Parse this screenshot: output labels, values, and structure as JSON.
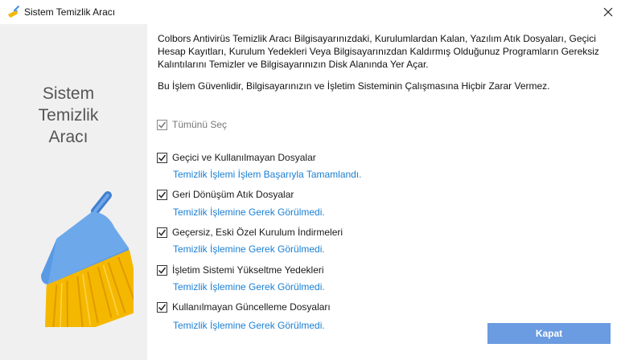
{
  "window": {
    "title": "Sistem Temizlik Aracı",
    "icon": "broom-icon"
  },
  "sidebar": {
    "heading": "Sistem\nTemizlik\nAracı",
    "illustration": "broom-icon"
  },
  "main": {
    "description": "Colbors Antivirüs Temizlik Aracı Bilgisayarınızdaki, Kurulumlardan Kalan, Yazılım Atık Dosyaları, Geçici Hesap Kayıtları, Kurulum Yedekleri Veya Bilgisayarınızdan Kaldırmış Olduğunuz Programların Gereksiz Kalıntılarını Temizler ve Bilgisayarınızın Disk Alanında Yer Açar.",
    "safety_note": "Bu İşlem Güvenlidir, Bilgisayarınızın ve İşletim Sisteminin Çalışmasına Hiçbir Zarar Vermez.",
    "select_all": {
      "label": "Tümünü Seç",
      "checked": true,
      "disabled": true
    },
    "items": [
      {
        "label": "Geçici ve Kullanılmayan Dosyalar",
        "checked": true,
        "status": "Temizlik İşlemi İşlem Başarıyla Tamamlandı."
      },
      {
        "label": "Geri Dönüşüm Atık Dosyalar",
        "checked": true,
        "status": "Temizlik İşlemine Gerek Görülmedi."
      },
      {
        "label": "Geçersiz, Eski Özel Kurulum İndirmeleri",
        "checked": true,
        "status": "Temizlik İşlemine Gerek Görülmedi."
      },
      {
        "label": "İşletim Sistemi Yükseltme Yedekleri",
        "checked": true,
        "status": "Temizlik İşlemine Gerek Görülmedi."
      },
      {
        "label": "Kullanılmayan Güncelleme Dosyaları",
        "checked": true,
        "status": "Temizlik İşlemine Gerek Görülmedi."
      }
    ],
    "close_button": "Kapat"
  },
  "colors": {
    "accent": "#1a7fd4",
    "button": "#6b9be0",
    "sidebar_bg": "#f0f0f0"
  }
}
